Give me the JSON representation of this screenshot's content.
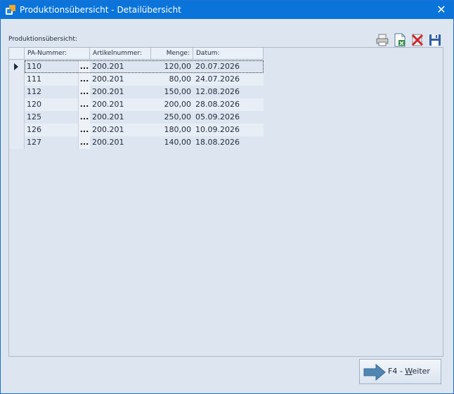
{
  "window": {
    "title": "Produktionsübersicht - Detailübersicht",
    "close_glyph": "✕"
  },
  "panel": {
    "label": "Produktionsübersicht:"
  },
  "toolbar": {
    "icons": [
      "printer-icon",
      "excel-export-icon",
      "delete-icon",
      "save-icon"
    ]
  },
  "table": {
    "columns": {
      "pa": "PA-Nummer:",
      "artikel": "Artikelnummer:",
      "menge": "Menge:",
      "datum": "Datum:"
    },
    "ellipsis": "...",
    "rows": [
      {
        "pa": "110",
        "artikel": "200.201",
        "menge": "120,00",
        "datum": "20.07.2026"
      },
      {
        "pa": "111",
        "artikel": "200.201",
        "menge": "80,00",
        "datum": "24.07.2026"
      },
      {
        "pa": "112",
        "artikel": "200.201",
        "menge": "150,00",
        "datum": "12.08.2026"
      },
      {
        "pa": "120",
        "artikel": "200.201",
        "menge": "200,00",
        "datum": "28.08.2026"
      },
      {
        "pa": "125",
        "artikel": "200.201",
        "menge": "250,00",
        "datum": "05.09.2026"
      },
      {
        "pa": "126",
        "artikel": "200.201",
        "menge": "180,00",
        "datum": "10.09.2026"
      },
      {
        "pa": "127",
        "artikel": "200.201",
        "menge": "140,00",
        "datum": "18.08.2026"
      }
    ]
  },
  "footer": {
    "next_button_prefix": "F4 - ",
    "next_button_hotkey": "W",
    "next_button_rest": "eiter"
  },
  "colors": {
    "titlebar": "#0a74da",
    "window_bg": "#dde6f0",
    "row_alt": "#e8eef6"
  }
}
